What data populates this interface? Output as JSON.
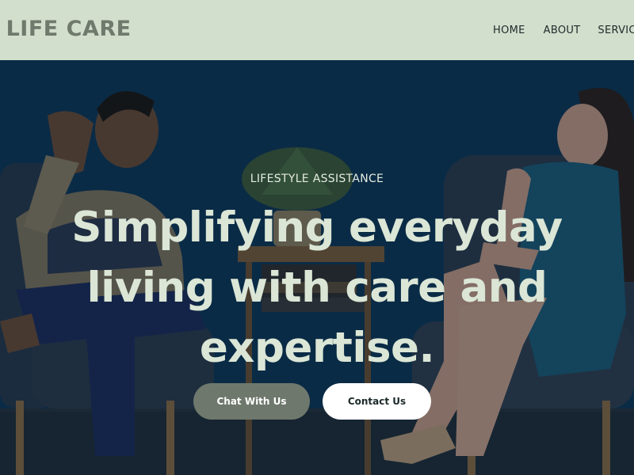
{
  "header": {
    "logo": "L LIFE CARE",
    "nav": [
      {
        "label": "HOME"
      },
      {
        "label": "ABOUT"
      },
      {
        "label": "SERVICES"
      }
    ]
  },
  "hero": {
    "eyebrow": "LIFESTYLE ASSISTANCE",
    "headline": "Simplifying everyday living with care and expertise.",
    "buttons": {
      "chat_label": "Chat With Us",
      "contact_label": "Contact Us"
    }
  },
  "colors": {
    "header_bg": "#d3dfcd",
    "logo_text": "#6f7a6d",
    "headline_text": "#dbe6d6",
    "chat_button_bg": "#6e786c",
    "contact_button_bg": "#ffffff",
    "hero_wall": "#0c3556"
  }
}
